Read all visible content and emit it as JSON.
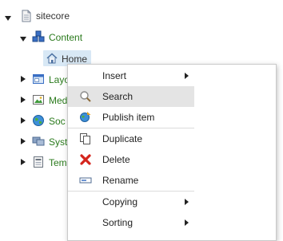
{
  "tree": {
    "root": {
      "label": "sitecore",
      "icon": "document-icon"
    },
    "content": {
      "label": "Content",
      "icon": "content-cubes-icon"
    },
    "home": {
      "label": "Home",
      "icon": "home-icon"
    },
    "items": [
      {
        "label": "Layo",
        "icon": "layout-window-icon"
      },
      {
        "label": "Med",
        "icon": "media-image-icon"
      },
      {
        "label": "Soc",
        "icon": "social-globe-icon"
      },
      {
        "label": "Syst",
        "icon": "system-icon"
      },
      {
        "label": "Tem",
        "icon": "template-icon"
      }
    ]
  },
  "context_menu": {
    "items": [
      {
        "label": "Insert",
        "icon": "",
        "submenu": true
      },
      {
        "label": "Search",
        "icon": "magnifier-icon",
        "highlighted": true
      },
      {
        "label": "Publish item",
        "icon": "publish-globe-icon"
      },
      {
        "label": "Duplicate",
        "icon": "duplicate-pages-icon"
      },
      {
        "label": "Delete",
        "icon": "red-x-icon"
      },
      {
        "label": "Rename",
        "icon": "rename-field-icon"
      },
      {
        "label": "Copying",
        "icon": "",
        "submenu": true
      },
      {
        "label": "Sorting",
        "icon": "",
        "submenu": true
      }
    ]
  },
  "colors": {
    "tree_green": "#2a7a1c",
    "selection": "#d8e8f5",
    "highlight": "#e4e4e4",
    "delete_red": "#d4241c"
  }
}
